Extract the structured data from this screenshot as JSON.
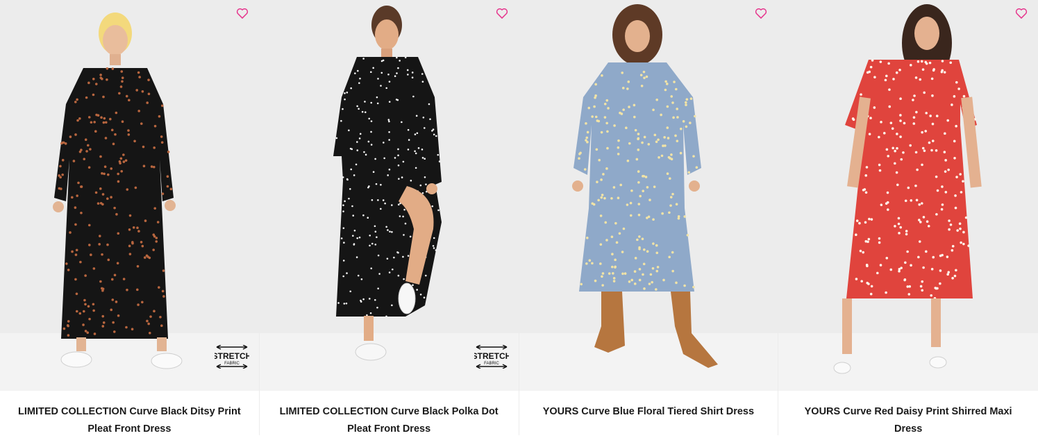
{
  "products": [
    {
      "name": "LIMITED COLLECTION Curve Black Ditsy Print Pleat Front Dress",
      "stretch_badge": {
        "line1": "STRETCH",
        "line2": "FABRIC"
      },
      "dress_color": "#151515",
      "print_color": "#b8663f",
      "background": "#ebebeb"
    },
    {
      "name": "LIMITED COLLECTION Curve Black Polka Dot Pleat Front Dress",
      "stretch_badge": {
        "line1": "STRETCH",
        "line2": "FABRIC"
      },
      "dress_color": "#151515",
      "print_color": "#f4f4f4",
      "background": "#ebebeb"
    },
    {
      "name": "YOURS Curve Blue Floral Tiered Shirt Dress",
      "dress_color": "#8fa9c9",
      "print_color": "#f1e3a6",
      "background": "#ebebeb"
    },
    {
      "name": "YOURS Curve Red Daisy Print Shirred Maxi Dress",
      "dress_color": "#e0443d",
      "print_color": "#fff5ea",
      "background": "#ebebeb"
    }
  ],
  "icons": {
    "wishlist": "heart-outline-icon",
    "wishlist_color": "#e6348c"
  }
}
